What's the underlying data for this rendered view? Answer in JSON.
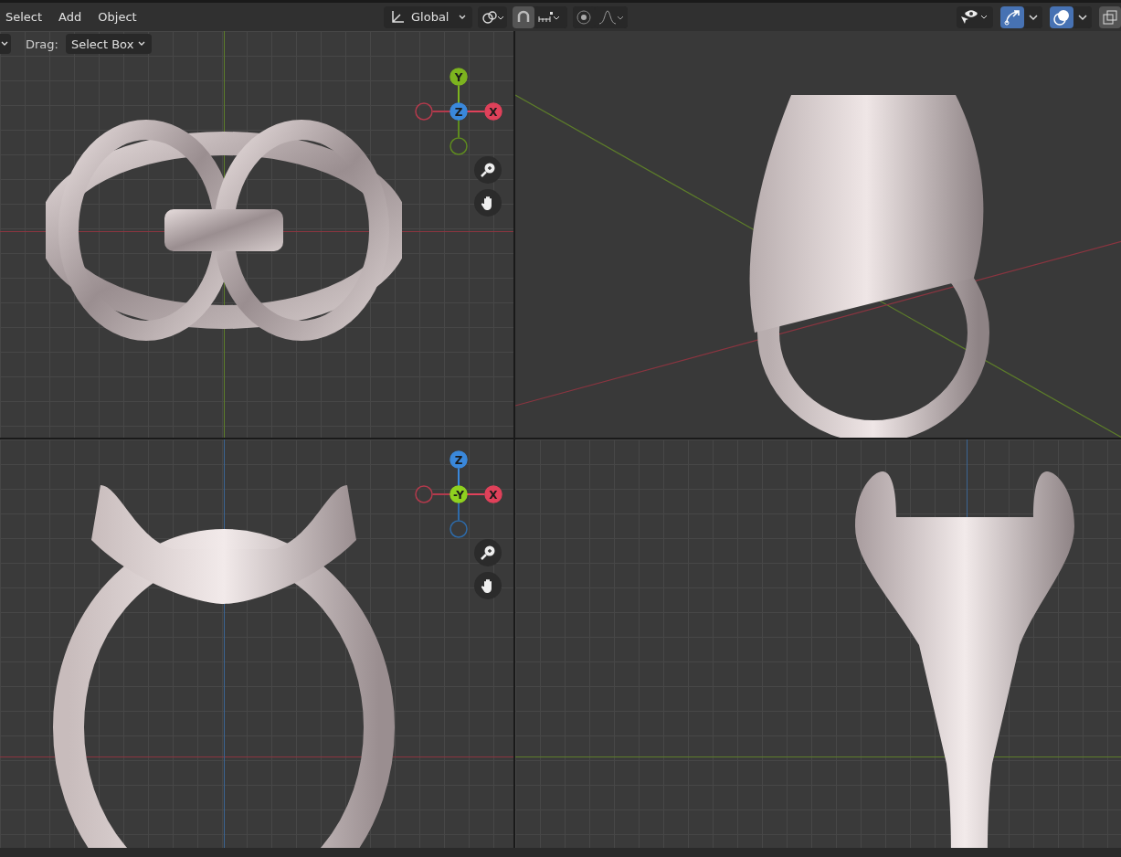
{
  "menu": [
    {
      "label": "Select"
    },
    {
      "label": "Add"
    },
    {
      "label": "Object"
    }
  ],
  "header": {
    "orientation": "Global",
    "snap_on": true,
    "proportional_on": false,
    "gizmos_on": true,
    "overlays_on": true
  },
  "tool_settings": {
    "drag_label": "Drag:",
    "drag_value": "Select Box"
  },
  "viewports": [
    {
      "kind": "top",
      "gizmo": [
        {
          "kind": "up",
          "label": "Y",
          "color": "#7db41f"
        },
        {
          "kind": "center",
          "label": "Z",
          "color": "#3a88db"
        },
        {
          "kind": "right",
          "label": "X",
          "color": "#e0415a"
        },
        {
          "kind": "left",
          "color": "#b33a4c"
        },
        {
          "kind": "down",
          "color": "#5e8a1f"
        }
      ]
    },
    {
      "kind": "perspective"
    },
    {
      "kind": "front",
      "gizmo": [
        {
          "kind": "up",
          "label": "Z",
          "color": "#3a88db"
        },
        {
          "kind": "center",
          "label": "-Y",
          "color": "#8fd11f"
        },
        {
          "kind": "right",
          "label": "X",
          "color": "#e0415a"
        },
        {
          "kind": "left",
          "color": "#b33a4c"
        },
        {
          "kind": "down",
          "color": "#2e6aa8"
        }
      ]
    },
    {
      "kind": "side"
    }
  ]
}
